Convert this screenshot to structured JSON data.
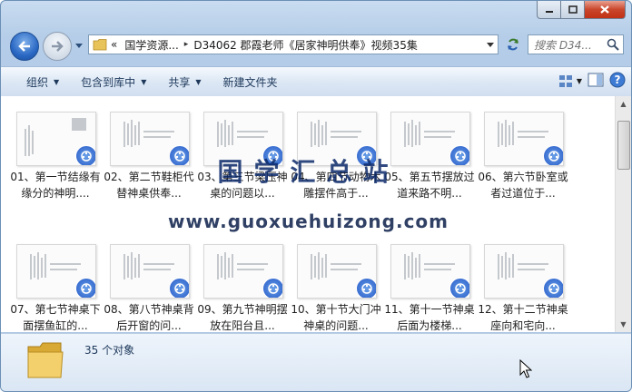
{
  "window": {
    "caption_buttons": {
      "minimize": "minimize-icon",
      "maximize": "maximize-icon",
      "close": "close-icon"
    }
  },
  "address": {
    "overflow": "«",
    "segments": [
      "国学资源...",
      "D34062 郡霞老师《居家神明供奉》视频35集"
    ],
    "separator": "▸"
  },
  "search": {
    "placeholder": "搜索 D34..."
  },
  "toolbar": {
    "organize": "组织",
    "include_in_library": "包含到库中",
    "share": "共享",
    "new_folder": "新建文件夹"
  },
  "files": [
    {
      "label": "01、第一节结缘有缘分的神明...."
    },
    {
      "label": "02、第二节鞋柜代替神桌供奉..."
    },
    {
      "label": "03、第三节梁压神桌的问题以..."
    },
    {
      "label": "04、第四节动物木雕摆件高于..."
    },
    {
      "label": "05、第五节摆放过道来路不明..."
    },
    {
      "label": "06、第六节卧室或者过道位于..."
    },
    {
      "label": "07、第七节神桌下面摆鱼缸的..."
    },
    {
      "label": "08、第八节神桌背后开窗的问..."
    },
    {
      "label": "09、第九节神明摆放在阳台且..."
    },
    {
      "label": "10、第十节大门冲神桌的问题..."
    },
    {
      "label": "11、第十一节神桌后面为楼梯..."
    },
    {
      "label": "12、第十二节神桌座向和宅向..."
    }
  ],
  "watermark": {
    "title": "国学汇总站",
    "url": "www.guoxuehuizong.com"
  },
  "details": {
    "count": "35 个对象"
  },
  "colors": {
    "accent": "#2458c7",
    "window_frame": "#aac4e3"
  }
}
